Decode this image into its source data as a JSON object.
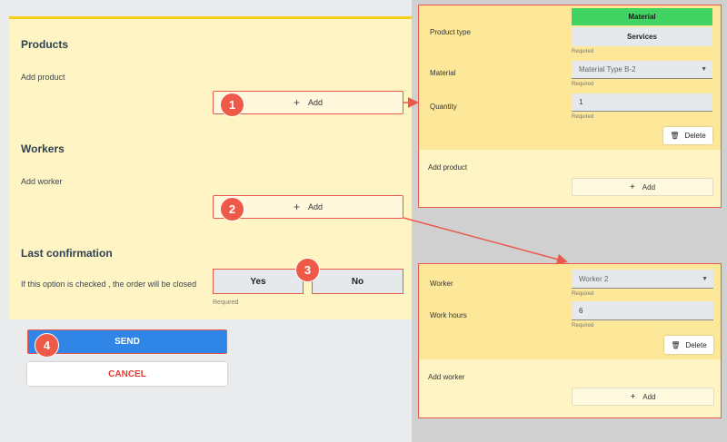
{
  "form": {
    "products_title": "Products",
    "add_product_label": "Add product",
    "add_button_label": "Add",
    "workers_title": "Workers",
    "add_worker_label": "Add worker",
    "confirmation_title": "Last confirmation",
    "confirmation_text": "If this option is checked , the order will be closed",
    "yes_label": "Yes",
    "no_label": "No",
    "required_text": "Required",
    "send_label": "SEND",
    "cancel_label": "CANCEL"
  },
  "badges": [
    "1",
    "2",
    "3",
    "4"
  ],
  "product_panel": {
    "product_type_label": "Product type",
    "material_option": "Material",
    "services_option": "Services",
    "required_text": "Required",
    "material_label": "Material",
    "material_value": "Material Type B-2",
    "quantity_label": "Quantity",
    "quantity_value": "1",
    "delete_label": "Delete",
    "add_product_label": "Add product",
    "add_label": "Add"
  },
  "worker_panel": {
    "worker_label": "Worker",
    "worker_value": "Worker 2",
    "required_text": "Required",
    "work_hours_label": "Work hours",
    "work_hours_value": "6",
    "delete_label": "Delete",
    "add_worker_label": "Add worker",
    "add_label": "Add"
  },
  "colors": {
    "accent_red": "#e85b4c",
    "send_blue": "#2f86e6",
    "material_green": "#42d462",
    "card_yellow": "#fff4c4"
  },
  "icons": [
    "plus-icon",
    "trash-icon",
    "chevron-down-icon"
  ]
}
